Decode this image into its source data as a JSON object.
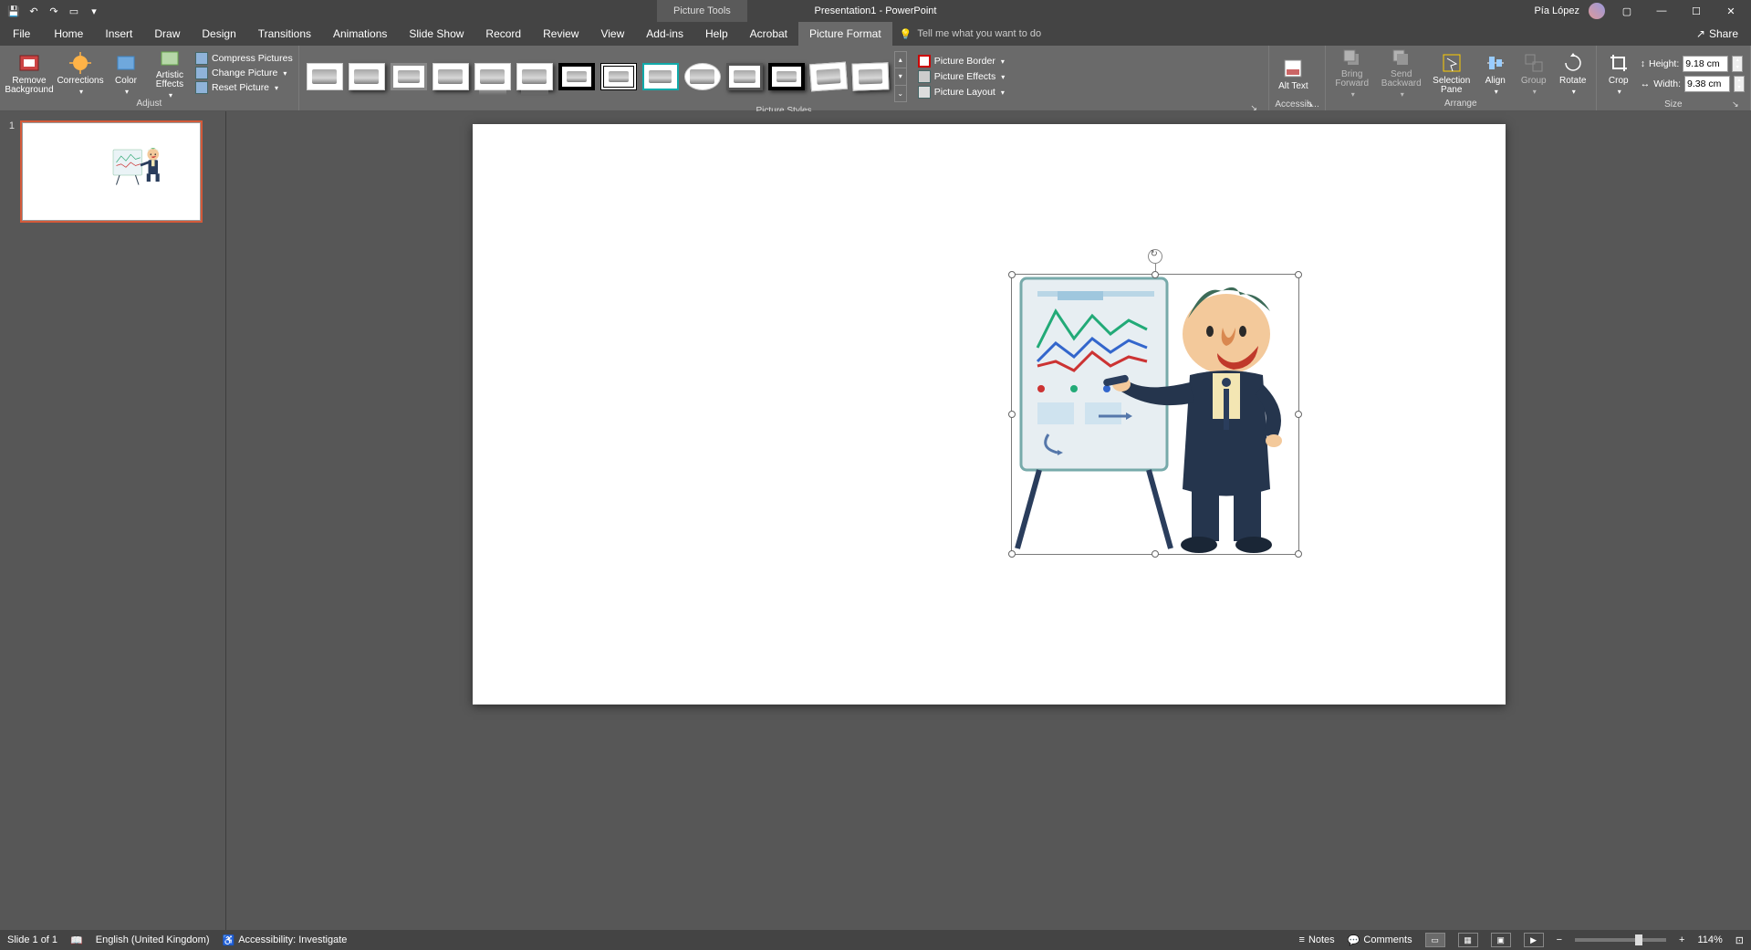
{
  "titlebar": {
    "doc_title": "Presentation1 - PowerPoint",
    "tool_tab": "Picture Tools",
    "user_name": "Pía López"
  },
  "menu": {
    "tabs": [
      "File",
      "Home",
      "Insert",
      "Draw",
      "Design",
      "Transitions",
      "Animations",
      "Slide Show",
      "Record",
      "Review",
      "View",
      "Add-ins",
      "Help",
      "Acrobat",
      "Picture Format"
    ],
    "active": "Picture Format",
    "tell_me": "Tell me what you want to do",
    "share": "Share"
  },
  "ribbon": {
    "adjust": {
      "remove_bg": "Remove Background",
      "corrections": "Corrections",
      "color": "Color",
      "artistic": "Artistic Effects",
      "compress": "Compress Pictures",
      "change": "Change Picture",
      "reset": "Reset Picture",
      "label": "Adjust"
    },
    "styles": {
      "border": "Picture Border",
      "effects": "Picture Effects",
      "layout": "Picture Layout",
      "label": "Picture Styles"
    },
    "access": {
      "alt_text": "Alt Text",
      "label": "Accessib..."
    },
    "arrange": {
      "bring_fwd": "Bring Forward",
      "send_back": "Send Backward",
      "sel_pane": "Selection Pane",
      "align": "Align",
      "group": "Group",
      "rotate": "Rotate",
      "label": "Arrange"
    },
    "size": {
      "crop": "Crop",
      "height_lbl": "Height:",
      "height_val": "9.18 cm",
      "width_lbl": "Width:",
      "width_val": "9.38 cm",
      "label": "Size"
    }
  },
  "thumbs": {
    "slide1_num": "1"
  },
  "status": {
    "slide": "Slide 1 of 1",
    "lang": "English (United Kingdom)",
    "access": "Accessibility: Investigate",
    "notes": "Notes",
    "comments": "Comments",
    "zoom": "114%"
  }
}
